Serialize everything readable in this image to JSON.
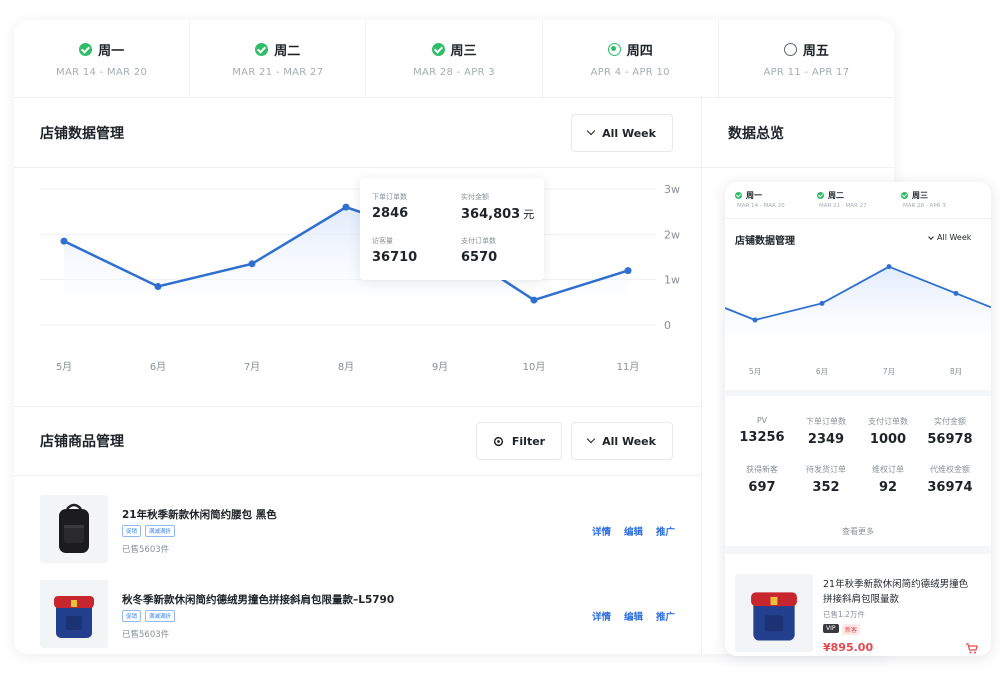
{
  "weeks": [
    {
      "label": "周一",
      "range": "MAR 14 - MAR 20",
      "status": "done"
    },
    {
      "label": "周二",
      "range": "MAR 21 - MAR 27",
      "status": "done"
    },
    {
      "label": "周三",
      "range": "MAR 28 - APR 3",
      "status": "done"
    },
    {
      "label": "周四",
      "range": "APR 4 - APR 10",
      "status": "current"
    },
    {
      "label": "周五",
      "range": "APR 11 - APR 17",
      "status": "todo"
    }
  ],
  "store_data": {
    "title": "店铺数据管理",
    "filter_label": "All Week"
  },
  "overview_title": "数据总览",
  "chart_data": {
    "type": "line",
    "categories": [
      "5月",
      "6月",
      "7月",
      "8月",
      "9月",
      "10月",
      "11月"
    ],
    "values": [
      18500,
      8500,
      13500,
      26000,
      19000,
      5500,
      12000
    ],
    "ylim": [
      0,
      30000
    ],
    "yticks": [
      "0",
      "1w",
      "2w",
      "3w"
    ],
    "line_color": "#2f6fcf",
    "tooltip": [
      {
        "key": "下单订单数",
        "value": "2846",
        "unit": ""
      },
      {
        "key": "实付金额",
        "value": "364,803",
        "unit": "元"
      },
      {
        "key": "访客量",
        "value": "36710",
        "unit": ""
      },
      {
        "key": "支付订单数",
        "value": "6570",
        "unit": ""
      }
    ]
  },
  "products_section": {
    "title": "店铺商品管理",
    "filter_button": "Filter",
    "period_button": "All Week"
  },
  "products": [
    {
      "name": "21年秋季新款休闲简约腰包 黑色",
      "tags": [
        "促销",
        "满减满折"
      ],
      "sold": "已售5603件",
      "actions": [
        "详情",
        "编辑",
        "推广"
      ],
      "image": "black-backpack"
    },
    {
      "name": "秋冬季新款休闲简约德绒男撞色拼接斜肩包限量款–L5790",
      "tags": [
        "促销",
        "满减满折"
      ],
      "sold": "已售5603件",
      "actions": [
        "详情",
        "编辑",
        "推广"
      ],
      "image": "red-blue-backpack"
    }
  ],
  "mobile": {
    "weeks": [
      {
        "label": "周一",
        "range": "MAR 14 - MAR 20"
      },
      {
        "label": "周二",
        "range": "MAR 21 - MAR 27"
      },
      {
        "label": "周三",
        "range": "MAR 28 - APR 3"
      }
    ],
    "title": "店铺数据管理",
    "filter_label": "All Week",
    "chart_data": {
      "type": "line",
      "categories": [
        "5月",
        "6月",
        "7月",
        "8月"
      ],
      "values": [
        12000,
        17000,
        28000,
        20000
      ]
    },
    "stats": [
      {
        "key": "PV",
        "value": "13256"
      },
      {
        "key": "下单订单数",
        "value": "2349"
      },
      {
        "key": "支付订单数",
        "value": "1000"
      },
      {
        "key": "实付金额",
        "value": "56978"
      },
      {
        "key": "获得新客",
        "value": "697"
      },
      {
        "key": "待发货订单",
        "value": "352"
      },
      {
        "key": "维权订单",
        "value": "92"
      },
      {
        "key": "代维权金额",
        "value": "36974"
      }
    ],
    "more_label": "查看更多",
    "product": {
      "name_line1": "21年秋季新款休闲简约德绒男撞色",
      "name_line2": "拼接斜肩包限量款",
      "sold": "已售1.2万件",
      "badge_vip": "VIP",
      "badge_new": "新客",
      "price": "¥895.00"
    }
  },
  "colors": {
    "accent": "#2f6fe0",
    "success": "#2dbd67",
    "price": "#e5484d"
  }
}
